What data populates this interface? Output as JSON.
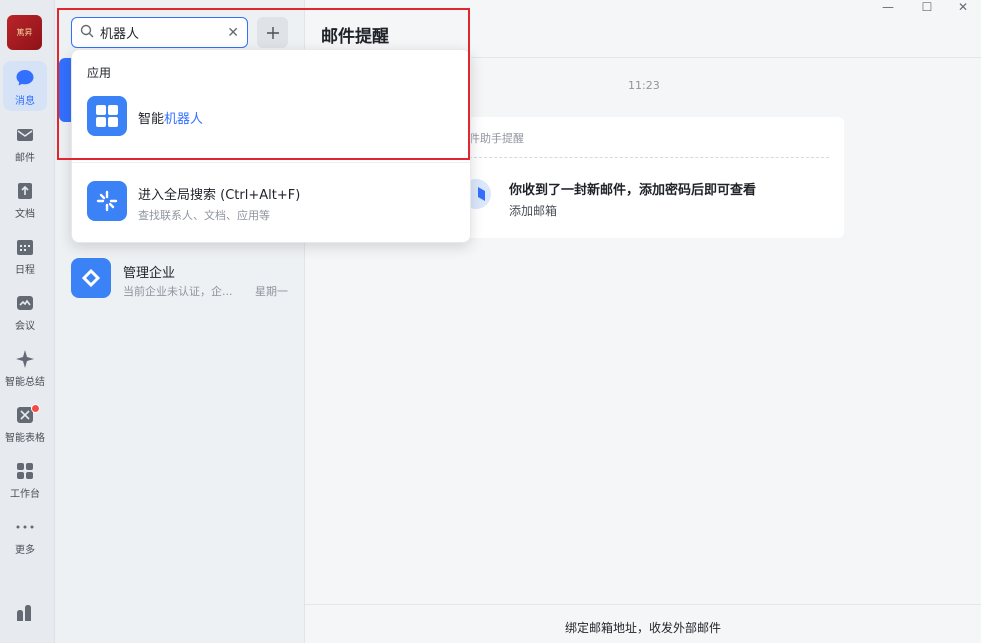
{
  "app": {
    "avatar_text": "篤昇"
  },
  "nav": [
    {
      "label": "消息",
      "icon": "chat-bubble-icon"
    },
    {
      "label": "邮件",
      "icon": "mail-icon"
    },
    {
      "label": "文档",
      "icon": "document-icon"
    },
    {
      "label": "日程",
      "icon": "calendar-icon"
    },
    {
      "label": "会议",
      "icon": "meeting-icon"
    },
    {
      "label": "智能总结",
      "icon": "sparkle-icon"
    },
    {
      "label": "智能表格",
      "icon": "smart-table-icon"
    },
    {
      "label": "工作台",
      "icon": "grid-icon"
    },
    {
      "label": "更多",
      "icon": "more-dots-icon"
    }
  ],
  "search": {
    "value": "机器人",
    "clear_icon": "close-icon"
  },
  "dropdown": {
    "section_label": "应用",
    "app_result": {
      "prefix": "智能",
      "highlight": "机器人"
    },
    "global_search": {
      "title": "进入全局搜索 (Ctrl+Alt+F)",
      "subtitle": "查找联系人、文档、应用等"
    }
  },
  "conversation": {
    "title": "管理企业",
    "subtitle": "当前企业未认证，企...",
    "time": "星期一"
  },
  "chat": {
    "title": "邮件提醒",
    "timestamp": "11:23",
    "card_header": "件助手提醒",
    "card_message": "你收到了一封新邮件，添加密码后即可查看",
    "card_link": "添加邮箱",
    "footer_text": "绑定邮箱地址，收发外部邮件"
  },
  "window_controls": [
    "—",
    "☐",
    "✕"
  ],
  "colors": {
    "accent": "#3370ff",
    "highlight_frame": "#e0262e"
  }
}
